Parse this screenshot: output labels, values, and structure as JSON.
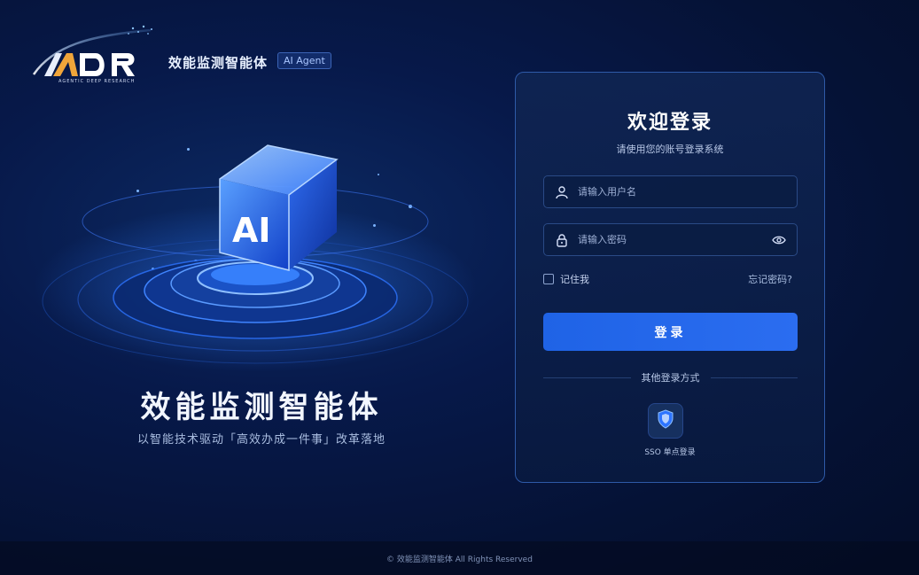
{
  "brand": {
    "logo_text": "ADR",
    "logo_subtitle": "AGENTIC DEEP RESEARCH",
    "title": "效能监测智能体",
    "tag": "AI Agent"
  },
  "hero": {
    "cube_label": "AI",
    "title": "效能监测智能体",
    "subtitle": "以智能技术驱动「高效办成一件事」改革落地"
  },
  "login": {
    "title": "欢迎登录",
    "subtitle": "请使用您的账号登录系统",
    "username_placeholder": "请输入用户名",
    "password_placeholder": "请输入密码",
    "remember_label": "记住我",
    "forgot_label": "忘记密码?",
    "submit_label": "登录",
    "other_methods_label": "其他登录方式",
    "sso_label": "SSO 单点登录"
  },
  "icons": {
    "user": "user-icon",
    "lock": "lock-icon",
    "eye": "eye-icon",
    "shield": "shield-icon"
  },
  "colors": {
    "accent": "#2468ea",
    "background": "#061540",
    "card_border": "#2e5aa8"
  },
  "footer": {
    "copyright": "© 效能监测智能体  All Rights Reserved"
  }
}
